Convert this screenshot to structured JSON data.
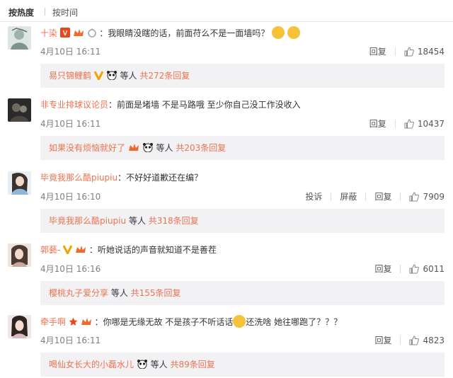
{
  "tabs": {
    "hot": "按热度",
    "time": "按时间"
  },
  "actions": {
    "reply": "回复",
    "report": "投诉",
    "block": "屏蔽"
  },
  "comments": [
    {
      "user": "十染",
      "text": "：我眼睛没瞎的话，前面苻么不是一面墙吗？",
      "time": "4月10日 16:11",
      "likes": "18454",
      "reply_user": "易只锦鲤鹤",
      "reply_mid": " 等人 ",
      "reply_count": "共272条回复"
    },
    {
      "user": "非专业排球议论员",
      "text": "：前面是堵墙 不是马路哦 至少你自己没工作没收入",
      "time": "4月10日 16:11",
      "likes": "10437",
      "reply_user": "如果没有烦恼就好了",
      "reply_mid": " 等人 ",
      "reply_count": "共203条回复"
    },
    {
      "user": "毕竟我那么酷piupiu",
      "text": "：不好好道歉还在编？",
      "time": "4月10日 16:10",
      "likes": "7909",
      "reply_user": "毕竟我那么酷piupiu",
      "reply_mid": " 等人 ",
      "reply_count": "共318条回复"
    },
    {
      "user": "郭藝-",
      "text": "：听她说话的声音就知道不是善茬",
      "time": "4月10日 16:16",
      "likes": "6011",
      "reply_user": "樱桃丸子爱分享",
      "reply_mid": " 等人 ",
      "reply_count": "共155条回复"
    },
    {
      "user": "牵手啊",
      "text": "：你哪是无缘无故 不是孩子不听话话",
      "text2": "还洗啥 她往哪跑了？？？",
      "time": "4月10日 16:11",
      "likes": "4823",
      "reply_user": "喝仙女长大的小磊水儿",
      "reply_mid": " 等人 ",
      "reply_count": "共89条回复"
    }
  ],
  "colors": {
    "username": "#eb7350",
    "meta": "#808080",
    "reply_bg": "#f2f2f5"
  }
}
